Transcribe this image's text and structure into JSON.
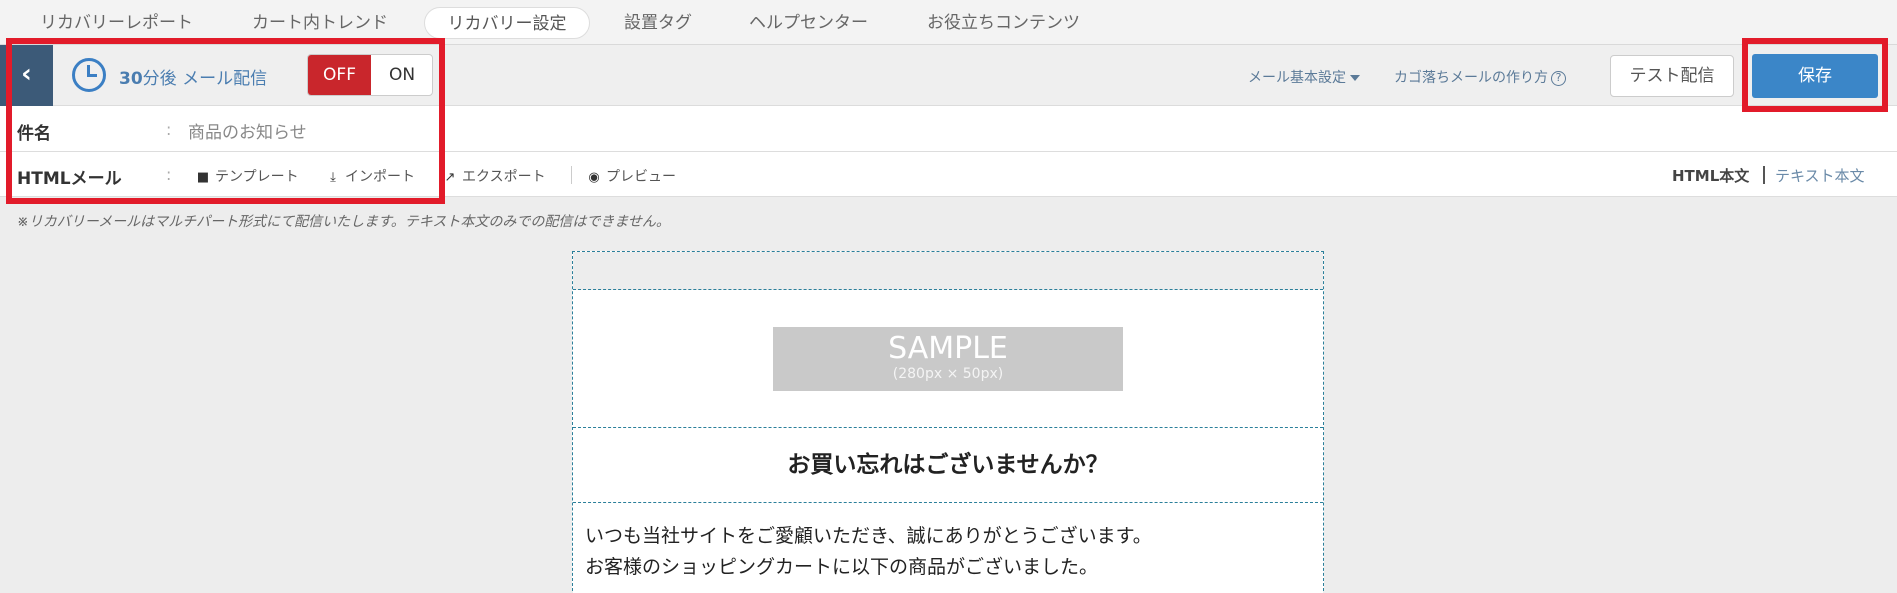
{
  "tabs": [
    {
      "label": "リカバリーレポート",
      "active": false
    },
    {
      "label": "カート内トレンド",
      "active": false
    },
    {
      "label": "リカバリー設定",
      "active": true
    },
    {
      "label": "設置タグ",
      "active": false
    },
    {
      "label": "ヘルプセンター",
      "active": false
    },
    {
      "label": "お役立ちコンテンツ",
      "active": false
    }
  ],
  "header": {
    "back_icon": "chevron-left-icon",
    "clock_icon": "clock-icon",
    "delay_number": "30",
    "delay_text": "分後 メール配信",
    "toggle_off": "OFF",
    "toggle_on": "ON",
    "toggle_state": "OFF",
    "mail_settings": "メール基本設定",
    "howto": "カゴ落ちメールの作り方",
    "howto_icon_glyph": "?",
    "test_send": "テスト配信",
    "save": "保存"
  },
  "subject": {
    "label": "件名",
    "colon": ":",
    "value": "商品のお知らせ"
  },
  "html_mail": {
    "label": "HTMLメール",
    "colon": ":",
    "tools": [
      {
        "label": "テンプレート",
        "icon": "document-icon"
      },
      {
        "label": "インポート",
        "icon": "import-icon"
      },
      {
        "label": "エクスポート",
        "icon": "export-icon"
      },
      {
        "label": "プレビュー",
        "icon": "eye-icon"
      }
    ],
    "body_tabs": {
      "html": "HTML本文",
      "text": "テキスト本文",
      "active": "html"
    }
  },
  "notice": "※リカバリーメールはマルチパート形式にて配信いたします。テキスト本文のみでの配信はできません。",
  "preview": {
    "sample_title": "SAMPLE",
    "sample_size": "(280px × 50px)",
    "heading": "お買い忘れはございませんか？",
    "body_lines": [
      "いつも当社サイトをご愛顧いただき、誠にありがとうございます。",
      "お客様のショッピングカートに以下の商品がございました。"
    ]
  },
  "colors": {
    "accent": "#3b86c8",
    "off_red": "#c9262c",
    "back_button": "#3c5a78",
    "annotation_red": "#e21b2a"
  }
}
